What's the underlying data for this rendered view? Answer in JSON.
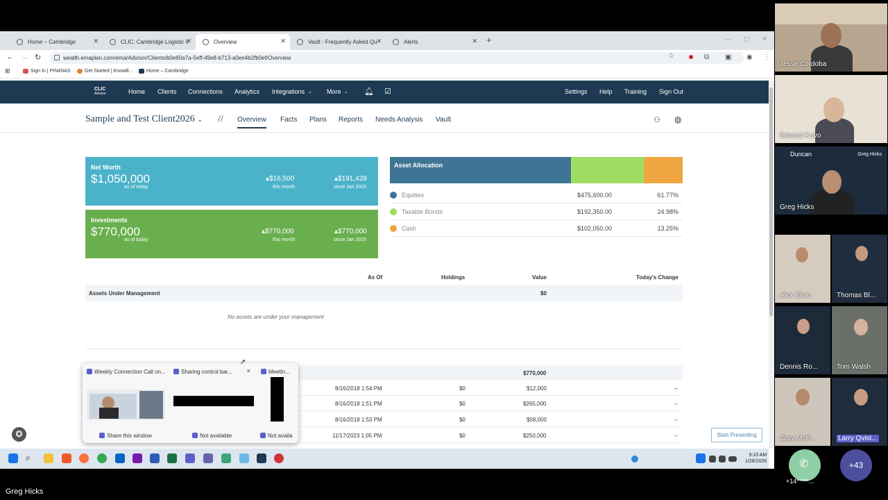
{
  "browser": {
    "tabs": [
      {
        "label": "Home – Cambridge"
      },
      {
        "label": "CLIC: Cambridge Logistic Infor"
      },
      {
        "label": "Overview"
      },
      {
        "label": "Vault - Frequently Asked Quest"
      },
      {
        "label": "Alerts"
      }
    ],
    "url": "wealth.emaplan.com/ema/Advisor/Clients/b0e60a7a-5eff-49e8-b713-a0ee4b2fb0ef/Overview",
    "bookmarks": [
      {
        "label": "Sign In | PIN4NAS",
        "color": "#d9534f"
      },
      {
        "label": "Get Started | KnowB...",
        "color": "#e0822d"
      },
      {
        "label": "Home – Cambridge",
        "color": "#1e3a52"
      }
    ]
  },
  "app": {
    "logo": {
      "title": "CLIC",
      "subtitle": "Advisor"
    },
    "nav": [
      "Home",
      "Clients",
      "Connections",
      "Analytics",
      "Integrations",
      "More"
    ],
    "nav_right": [
      "Settings",
      "Help",
      "Training",
      "Sign Out"
    ],
    "client_name": "Sample and Test Client2026",
    "separator": "//",
    "subtabs": [
      "Overview",
      "Facts",
      "Plans",
      "Reports",
      "Needs Analysis",
      "Vault"
    ],
    "active_subtab": "Overview"
  },
  "net_worth": {
    "title": "Net Worth",
    "value": "$1,050,000",
    "as_of": "as of today",
    "month_change": "$16,500",
    "month_label": "this month",
    "ytd_change": "$191,428",
    "ytd_label": "since Jan 2025",
    "color": "#4bb3c9"
  },
  "investments": {
    "title": "Investments",
    "value": "$770,000",
    "as_of": "as of today",
    "month_change": "$770,000",
    "month_label": "this month",
    "ytd_change": "$770,000",
    "ytd_label": "since Jan 2025",
    "color": "#6aaf4e"
  },
  "asset_allocation": {
    "title": "Asset Allocation",
    "items": [
      {
        "name": "Equities",
        "value": "$475,600.00",
        "pct": "61.77%",
        "fraction": 0.6177,
        "color": "#3f7594"
      },
      {
        "name": "Taxable Bonds",
        "value": "$192,350.00",
        "pct": "24.98%",
        "fraction": 0.2498,
        "color": "#a0dd64"
      },
      {
        "name": "Cash",
        "value": "$102,050.00",
        "pct": "13.25%",
        "fraction": 0.1325,
        "color": "#f0a640"
      }
    ]
  },
  "table": {
    "headers": {
      "as_of": "As Of",
      "holdings": "Holdings",
      "value": "Value",
      "change": "Today's Change"
    },
    "aum_label": "Assets Under Management",
    "aum_value": "$0",
    "no_assets": "No assets are under your management",
    "investments_total": "$770,000",
    "rows": [
      {
        "date": "8/16/2018 1:54 PM",
        "holdings": "$0",
        "value": "$12,000",
        "change": "–"
      },
      {
        "date": "8/16/2018 1:51 PM",
        "holdings": "$0",
        "value": "$265,000",
        "change": "–"
      },
      {
        "date": "8/16/2018 1:53 PM",
        "holdings": "$0",
        "value": "$58,000",
        "change": "–"
      },
      {
        "date": "11/17/2023 1:05 PM",
        "holdings": "$0",
        "value": "$250,000",
        "change": "–"
      }
    ]
  },
  "start_presenting": "Start Presenting",
  "share_popup": {
    "windows": [
      {
        "title": "Weekly Connection Call on...",
        "action": "Share this window"
      },
      {
        "title": "Sharing control bar...",
        "action": "Not available"
      },
      {
        "title": "Meetin...",
        "action": "Not availa"
      }
    ]
  },
  "taskbar": {
    "time": "9:10 AM",
    "date": "1/28/2026"
  },
  "participants": {
    "featured": [
      "Jesse Cordoba",
      "Edward Kavo",
      "Greg Hicks"
    ],
    "pairs": [
      [
        "Alex Kline",
        "Thomas Bl..."
      ],
      [
        "Dennis Ro...",
        "Tom Walsh"
      ],
      [
        "Gary McP...",
        "Larry Qvist..."
      ]
    ],
    "greg_overlay": {
      "brand": "Duncan",
      "name": "Greg Hicks"
    },
    "phone_label": "+14*****...",
    "more_count": "+43",
    "presenter": "Greg Hicks"
  }
}
